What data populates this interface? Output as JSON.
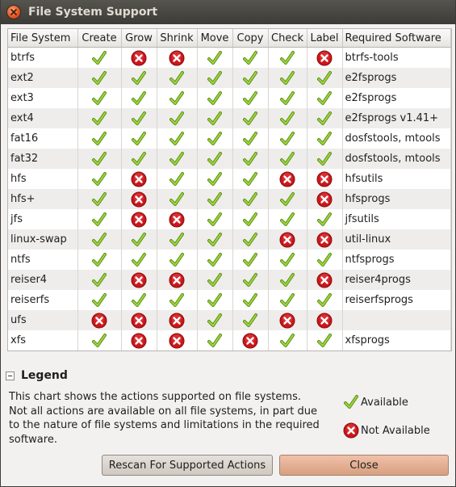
{
  "window": {
    "title": "File System Support"
  },
  "table": {
    "columns": [
      "File System",
      "Create",
      "Grow",
      "Shrink",
      "Move",
      "Copy",
      "Check",
      "Label",
      "Required Software"
    ],
    "rows": [
      {
        "fs": "btrfs",
        "flags": [
          1,
          0,
          0,
          1,
          1,
          1,
          0
        ],
        "software": "btrfs-tools"
      },
      {
        "fs": "ext2",
        "flags": [
          1,
          1,
          1,
          1,
          1,
          1,
          1
        ],
        "software": "e2fsprogs"
      },
      {
        "fs": "ext3",
        "flags": [
          1,
          1,
          1,
          1,
          1,
          1,
          1
        ],
        "software": "e2fsprogs"
      },
      {
        "fs": "ext4",
        "flags": [
          1,
          1,
          1,
          1,
          1,
          1,
          1
        ],
        "software": "e2fsprogs v1.41+"
      },
      {
        "fs": "fat16",
        "flags": [
          1,
          1,
          1,
          1,
          1,
          1,
          1
        ],
        "software": "dosfstools, mtools"
      },
      {
        "fs": "fat32",
        "flags": [
          1,
          1,
          1,
          1,
          1,
          1,
          1
        ],
        "software": "dosfstools, mtools"
      },
      {
        "fs": "hfs",
        "flags": [
          1,
          0,
          1,
          1,
          1,
          0,
          0
        ],
        "software": "hfsutils"
      },
      {
        "fs": "hfs+",
        "flags": [
          1,
          0,
          1,
          1,
          1,
          1,
          0
        ],
        "software": "hfsprogs"
      },
      {
        "fs": "jfs",
        "flags": [
          1,
          0,
          0,
          1,
          1,
          1,
          1
        ],
        "software": "jfsutils"
      },
      {
        "fs": "linux-swap",
        "flags": [
          1,
          1,
          1,
          1,
          1,
          0,
          0
        ],
        "software": "util-linux"
      },
      {
        "fs": "ntfs",
        "flags": [
          1,
          1,
          1,
          1,
          1,
          1,
          1
        ],
        "software": "ntfsprogs"
      },
      {
        "fs": "reiser4",
        "flags": [
          1,
          0,
          0,
          1,
          1,
          1,
          0
        ],
        "software": "reiser4progs"
      },
      {
        "fs": "reiserfs",
        "flags": [
          1,
          1,
          1,
          1,
          1,
          1,
          1
        ],
        "software": "reiserfsprogs"
      },
      {
        "fs": "ufs",
        "flags": [
          0,
          0,
          0,
          1,
          1,
          0,
          0
        ],
        "software": ""
      },
      {
        "fs": "xfs",
        "flags": [
          1,
          0,
          0,
          1,
          0,
          1,
          1
        ],
        "software": "xfsprogs"
      }
    ]
  },
  "legend": {
    "title": "Legend",
    "lines": [
      "This chart shows the actions supported on file systems.",
      "Not all actions are available on all file systems, in part due",
      "to the nature of file systems and limitations in the required",
      "software."
    ],
    "available_label": "Available",
    "not_available_label": "Not Available"
  },
  "buttons": {
    "rescan": "Rescan For Supported Actions",
    "close": "Close"
  },
  "icons": {
    "available": "check-icon",
    "not_available": "red-x-icon",
    "window_close": "close-icon"
  },
  "colors": {
    "titlebar": "#3c3b37",
    "check": "#7ab51d",
    "cross": "#d21b1b",
    "close_button": "#e4531b"
  }
}
